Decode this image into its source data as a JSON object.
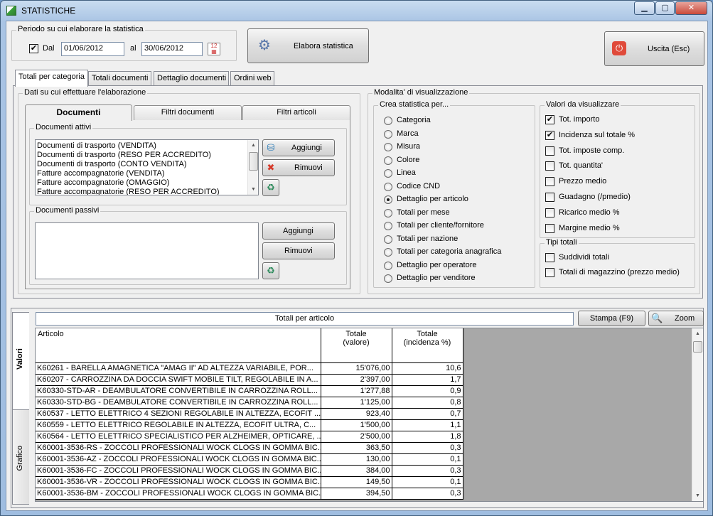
{
  "window": {
    "title": "STATISTICHE",
    "min": "▁",
    "max": "▢",
    "close": "✕"
  },
  "periodo": {
    "legend": "Periodo su cui elaborare la statistica",
    "dal_label": "Dal",
    "dal_checked": true,
    "dal_value": "01/06/2012",
    "al_label": "al",
    "al_value": "30/06/2012"
  },
  "toolbar": {
    "elabora_label": "Elabora statistica",
    "uscita_label": "Uscita (Esc)"
  },
  "main_tabs": [
    {
      "label": "Totali per categoria",
      "active": true
    },
    {
      "label": "Totali documenti",
      "active": false
    },
    {
      "label": "Dettaglio documenti",
      "active": false
    },
    {
      "label": "Ordini web",
      "active": false
    }
  ],
  "dati": {
    "legend": "Dati su cui effettuare l'elaborazione",
    "subtabs": [
      "Documenti",
      "Filtri documenti",
      "Filtri articoli"
    ],
    "attivi": {
      "legend": "Documenti attivi",
      "items": [
        "Documenti di trasporto (VENDITA)",
        "Documenti di trasporto (RESO PER ACCREDITO)",
        "Documenti di trasporto (CONTO VENDITA)",
        "Fatture accompagnatorie (VENDITA)",
        "Fatture accompagnatorie (OMAGGIO)",
        "Fatture accompagnatorie (RESO PER ACCREDITO)"
      ],
      "aggiungi": "Aggiungi",
      "rimuovi": "Rimuovi"
    },
    "passivi": {
      "legend": "Documenti passivi",
      "items": [],
      "aggiungi": "Aggiungi",
      "rimuovi": "Rimuovi"
    }
  },
  "modalita": {
    "legend": "Modalita' di visualizzazione",
    "crea": {
      "legend": "Crea statistica per...",
      "options": [
        {
          "label": "Categoria",
          "checked": false
        },
        {
          "label": "Marca",
          "checked": false
        },
        {
          "label": "Misura",
          "checked": false
        },
        {
          "label": "Colore",
          "checked": false
        },
        {
          "label": "Linea",
          "checked": false
        },
        {
          "label": "Codice CND",
          "checked": false
        },
        {
          "label": "Dettaglio per articolo",
          "checked": true
        },
        {
          "label": "Totali per mese",
          "checked": false
        },
        {
          "label": "Totali per cliente/fornitore",
          "checked": false
        },
        {
          "label": "Totali per nazione",
          "checked": false
        },
        {
          "label": "Totali per categoria anagrafica",
          "checked": false
        },
        {
          "label": "Dettaglio per operatore",
          "checked": false
        },
        {
          "label": "Dettaglio per venditore",
          "checked": false
        }
      ]
    },
    "valori": {
      "legend": "Valori da visualizzare",
      "options": [
        {
          "label": "Tot. importo",
          "checked": true
        },
        {
          "label": "Incidenza sul totale %",
          "checked": true
        },
        {
          "label": "Tot. imposte comp.",
          "checked": false
        },
        {
          "label": "Tot. quantita'",
          "checked": false
        },
        {
          "label": "Prezzo medio",
          "checked": false
        },
        {
          "label": "Guadagno (/pmedio)",
          "checked": false
        },
        {
          "label": "Ricarico medio %",
          "checked": false
        },
        {
          "label": "Margine medio %",
          "checked": false
        }
      ]
    },
    "tipi": {
      "legend": "Tipi totali",
      "options": [
        {
          "label": "Suddividi totali",
          "checked": false
        },
        {
          "label": "Totali di magazzino (prezzo medio)",
          "checked": false
        }
      ]
    }
  },
  "results": {
    "side_tabs": [
      "Valori",
      "Grafico"
    ],
    "title": "Totali per articolo",
    "stampa": "Stampa (F9)",
    "zoom": "Zoom",
    "columns": [
      "Articolo",
      "Totale\n(valore)",
      "Totale\n(incidenza %)"
    ],
    "rows": [
      [
        "K60261 -  BARELLA AMAGNETICA \"AMAG II\" AD ALTEZZA VARIABILE, POR...",
        "15'076,00",
        "10,6"
      ],
      [
        "K60207 -  CARROZZINA DA DOCCIA SWIFT MOBILE TILT, REGOLABILE IN A...",
        "2'397,00",
        "1,7"
      ],
      [
        "K60330-STD-AR -  DEAMBULATORE CONVERTIBILE IN CARROZZINA ROLL...",
        "1'277,88",
        "0,9"
      ],
      [
        "K60330-STD-BG -  DEAMBULATORE CONVERTIBILE IN CARROZZINA ROLL...",
        "1'125,00",
        "0,8"
      ],
      [
        "K60537 -  LETTO ELETTRICO 4 SEZIONI REGOLABILE IN ALTEZZA, ECOFIT ...",
        "923,40",
        "0,7"
      ],
      [
        "K60559 -  LETTO ELETTRICO REGOLABILE IN ALTEZZA, ECOFIT ULTRA, C...",
        "1'500,00",
        "1,1"
      ],
      [
        "K60564 -  LETTO ELETTRICO SPECIALISTICO PER ALZHEIMER, OPTICARE, ...",
        "2'500,00",
        "1,8"
      ],
      [
        "K60001-3536-RS -  ZOCCOLI PROFESSIONALI WOCK CLOGS IN GOMMA BIC...",
        "363,50",
        "0,3"
      ],
      [
        "K60001-3536-AZ -  ZOCCOLI PROFESSIONALI WOCK CLOGS IN GOMMA BIC...",
        "130,00",
        "0,1"
      ],
      [
        "K60001-3536-FC -  ZOCCOLI PROFESSIONALI WOCK CLOGS IN GOMMA BIC...",
        "384,00",
        "0,3"
      ],
      [
        "K60001-3536-VR -  ZOCCOLI PROFESSIONALI WOCK CLOGS IN GOMMA BIC...",
        "149,50",
        "0,1"
      ],
      [
        "K60001-3536-BM -  ZOCCOLI PROFESSIONALI WOCK CLOGS IN GOMMA BIC...",
        "394,50",
        "0,3"
      ]
    ]
  },
  "icons": {
    "calendar": "calendar-icon",
    "elabora": "gear-document-icon",
    "uscita": "power-icon",
    "add": "database-add-icon",
    "remove": "red-x-icon",
    "clear": "recycle-bin-icon",
    "zoom": "magnifier-icon"
  }
}
